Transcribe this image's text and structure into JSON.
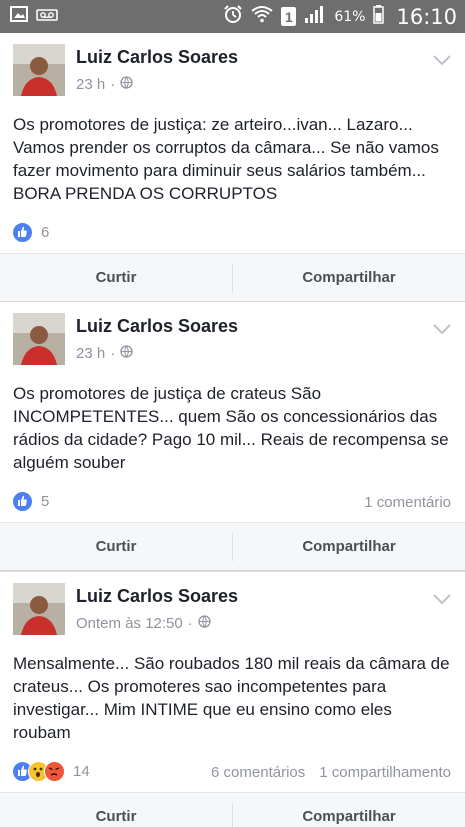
{
  "statusbar": {
    "battery_pct": "61%",
    "time": "16:10",
    "sim_badge": "1"
  },
  "posts": [
    {
      "author": "Luiz Carlos Soares",
      "time": "23 h",
      "text": "Os promotores de justiça: ze arteiro...ivan... Lazaro... Vamos prender os corruptos da câmara... Se não vamos fazer movimento para diminuir seus salários também... BORA PRENDA OS CORRUPTOS",
      "reaction_count": "6",
      "comments": "",
      "shares": "",
      "like_label": "Curtir",
      "share_label": "Compartilhar"
    },
    {
      "author": "Luiz Carlos Soares",
      "time": "23 h",
      "text": "Os promotores de justiça de crateus São INCOMPETENTES... quem São os concessionários das rádios da cidade? Pago 10 mil... Reais de recompensa se alguém souber",
      "reaction_count": "5",
      "comments": "1 comentário",
      "shares": "",
      "like_label": "Curtir",
      "share_label": "Compartilhar"
    },
    {
      "author": "Luiz Carlos Soares",
      "time": "Ontem às 12:50",
      "text": "Mensalmente... São roubados 180 mil reais da câmara de crateus... Os promoteres sao incompetentes para investigar... Mim INTIME que eu ensino como eles roubam",
      "reaction_count": "14",
      "comments": "6 comentários",
      "shares": "1 compartilhamento",
      "like_label": "Curtir",
      "share_label": "Compartilhar"
    }
  ],
  "colors": {
    "like_blue": "#4c7fef",
    "wow_yellow": "#f7c22f",
    "angry_red": "#f0563a",
    "statusbar": "#6e6e6e"
  }
}
